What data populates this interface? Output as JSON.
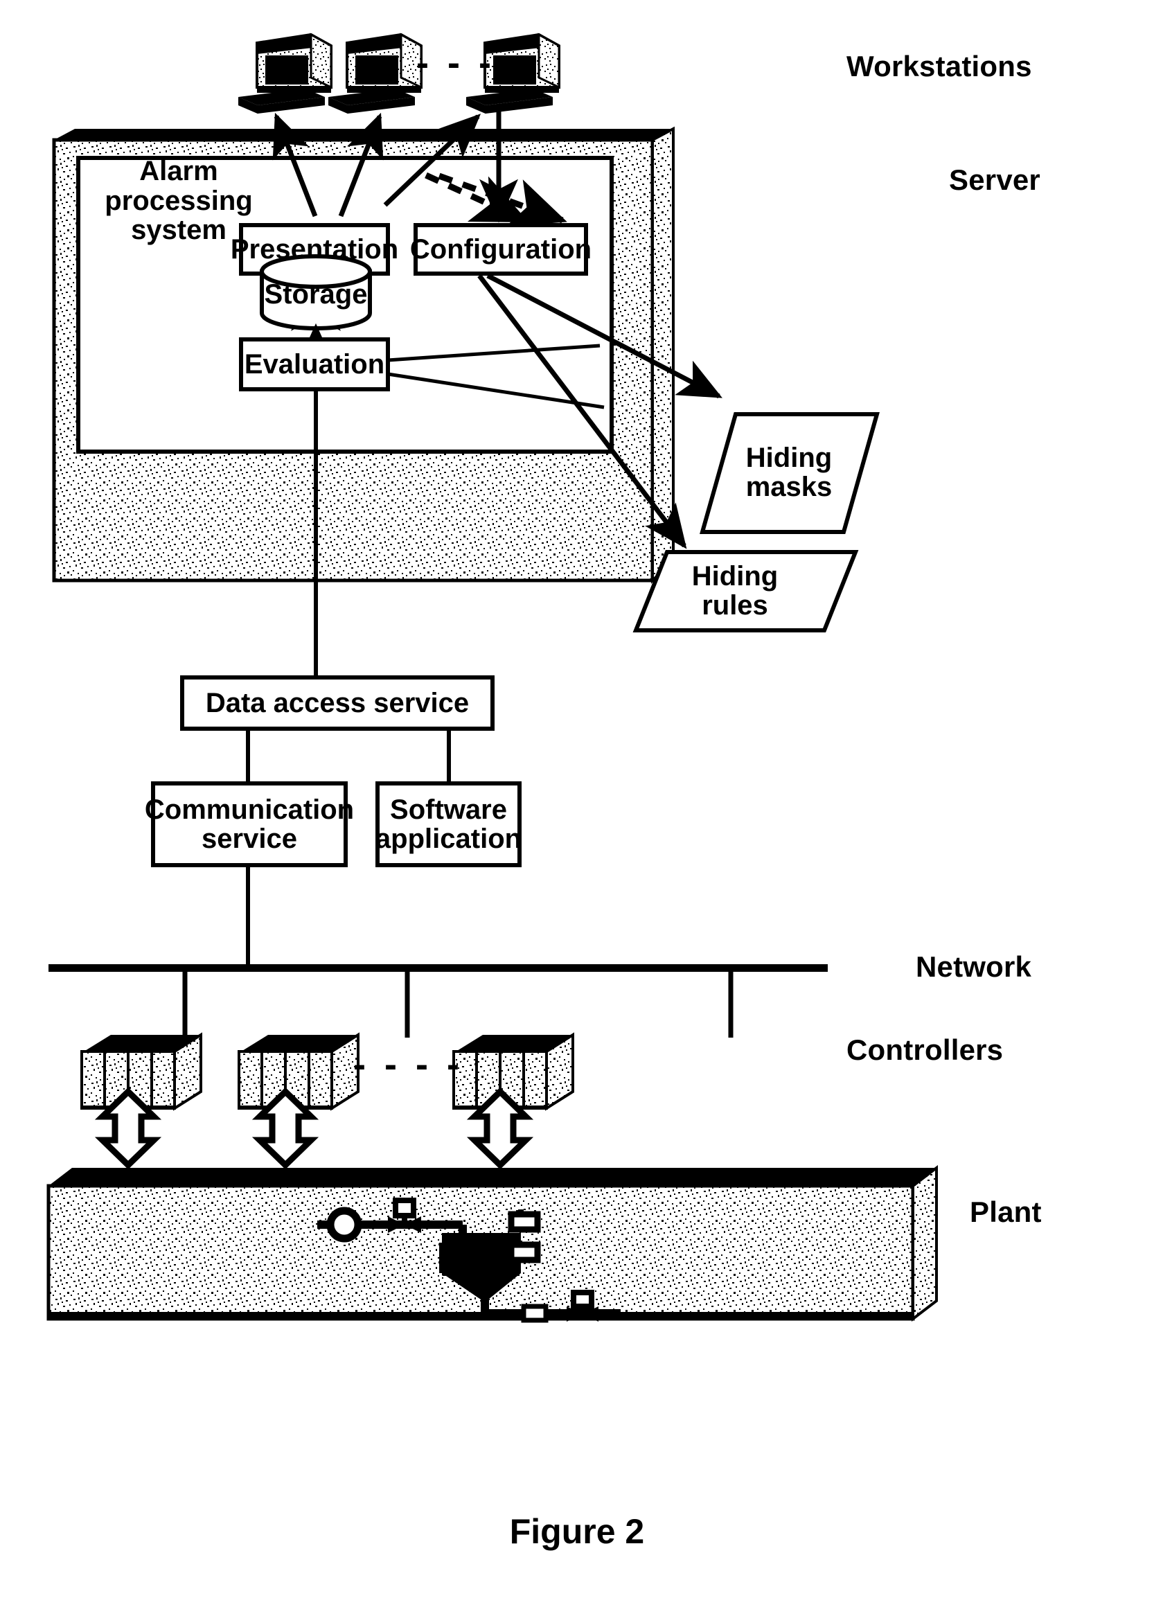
{
  "figure": {
    "caption": "Figure 2"
  },
  "side_labels": {
    "workstations": "Workstations",
    "server": "Server",
    "network": "Network",
    "controllers": "Controllers",
    "plant": "Plant"
  },
  "server": {
    "subsystem_title_lines": [
      "Alarm",
      "processing",
      "system"
    ],
    "blocks": {
      "presentation": "Presentation",
      "configuration": "Configuration",
      "storage": "Storage",
      "evaluation": "Evaluation",
      "hiding_masks_lines": [
        "Hiding",
        "masks"
      ],
      "hiding_rules_lines": [
        "Hiding",
        "rules"
      ],
      "data_access_service": "Data access service",
      "communication_service_lines": [
        "Communication",
        "service"
      ],
      "software_application_lines": [
        "Software",
        "application"
      ]
    }
  },
  "workstations": {
    "count_shown": 3,
    "ellipsis": "- - -"
  },
  "controllers": {
    "count_shown": 3,
    "ellipsis": "- - - -"
  },
  "colors": {
    "ink": "#000000",
    "paper": "#ffffff",
    "slab_fill": "#f2f2f2",
    "slab_speckle": "#000000"
  }
}
